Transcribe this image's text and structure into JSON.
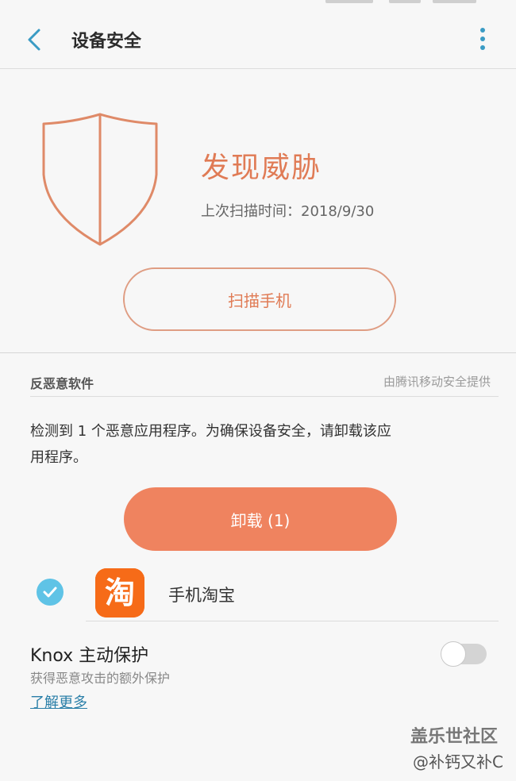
{
  "header": {
    "title": "设备安全",
    "back_icon": "chevron-left-icon",
    "more_icon": "more-vertical-icon"
  },
  "hero": {
    "status_title": "发现威胁",
    "last_scan_label": "上次扫描时间：2018/9/30",
    "scan_button_label": "扫描手机",
    "shield_icon": "shield-icon"
  },
  "antimalware": {
    "section_title": "反恶意软件",
    "provider": "由腾讯移动安全提供",
    "description": "检测到 1 个恶意应用程序。为确保设备安全，请卸载该应用程序。",
    "uninstall_button_label": "卸载 (1)",
    "apps": [
      {
        "name": "手机淘宝",
        "selected": true,
        "icon_glyph": "淘"
      }
    ]
  },
  "knox": {
    "title": "Knox 主动保护",
    "subtitle": "获得恶意攻击的额外保护",
    "learn_more": "了解更多",
    "toggle_on": false
  },
  "watermark": {
    "brand": "盖乐世社区",
    "user": "@补钙又补C"
  },
  "colors": {
    "accent_orange": "#e07b55",
    "button_fill": "#ef835f",
    "check_blue": "#5fc3e6",
    "link_blue": "#2a7fa8",
    "taobao_orange": "#f66b18"
  }
}
